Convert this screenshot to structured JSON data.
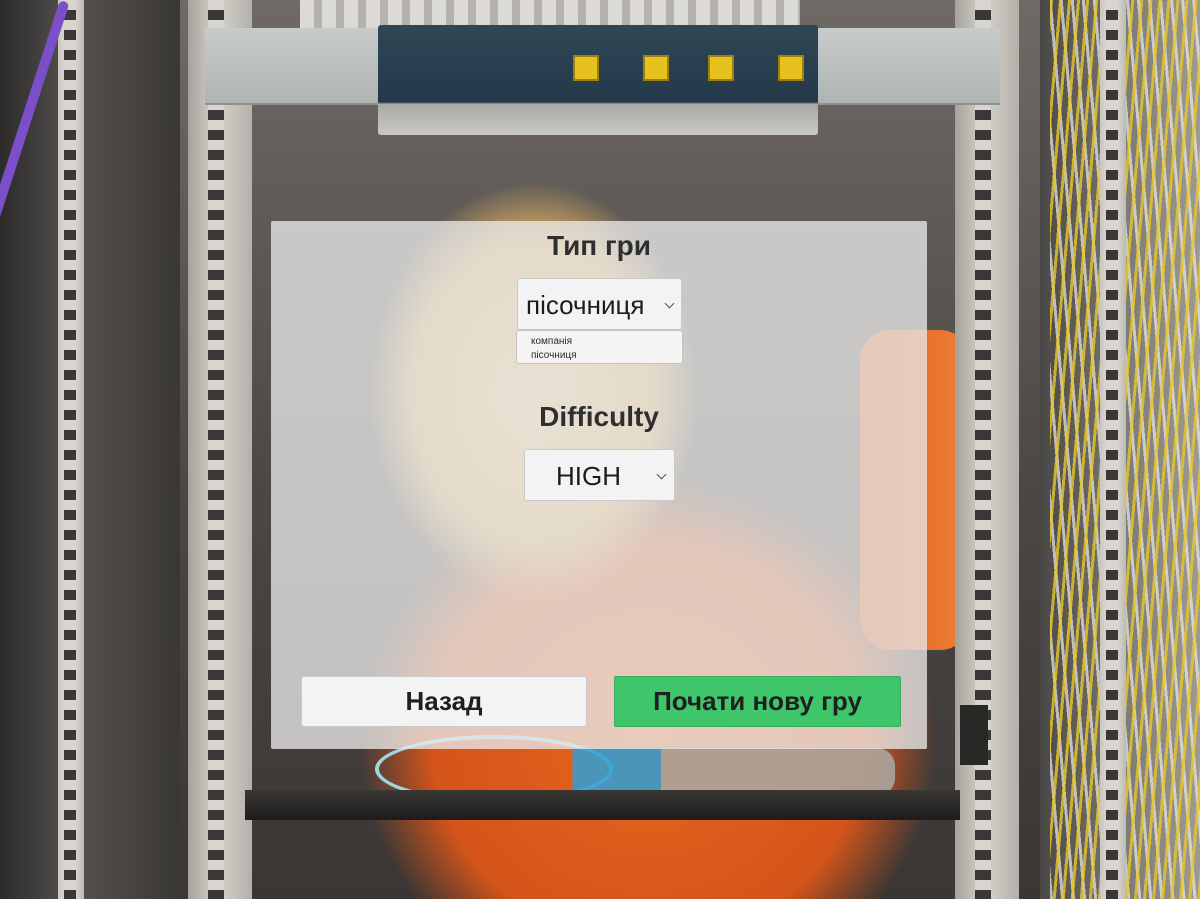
{
  "game_type": {
    "heading": "Тип гри",
    "selected": "пісочниця",
    "options": [
      "компанія",
      "пісочниця"
    ]
  },
  "difficulty": {
    "heading": "Difficulty",
    "selected": "HIGH"
  },
  "buttons": {
    "back": "Назад",
    "start": "Почати нову гру"
  },
  "colors": {
    "start_button": "#3fc56a",
    "panel_overlay": "#e8e8e8",
    "heading_text": "#2f2f2f"
  }
}
